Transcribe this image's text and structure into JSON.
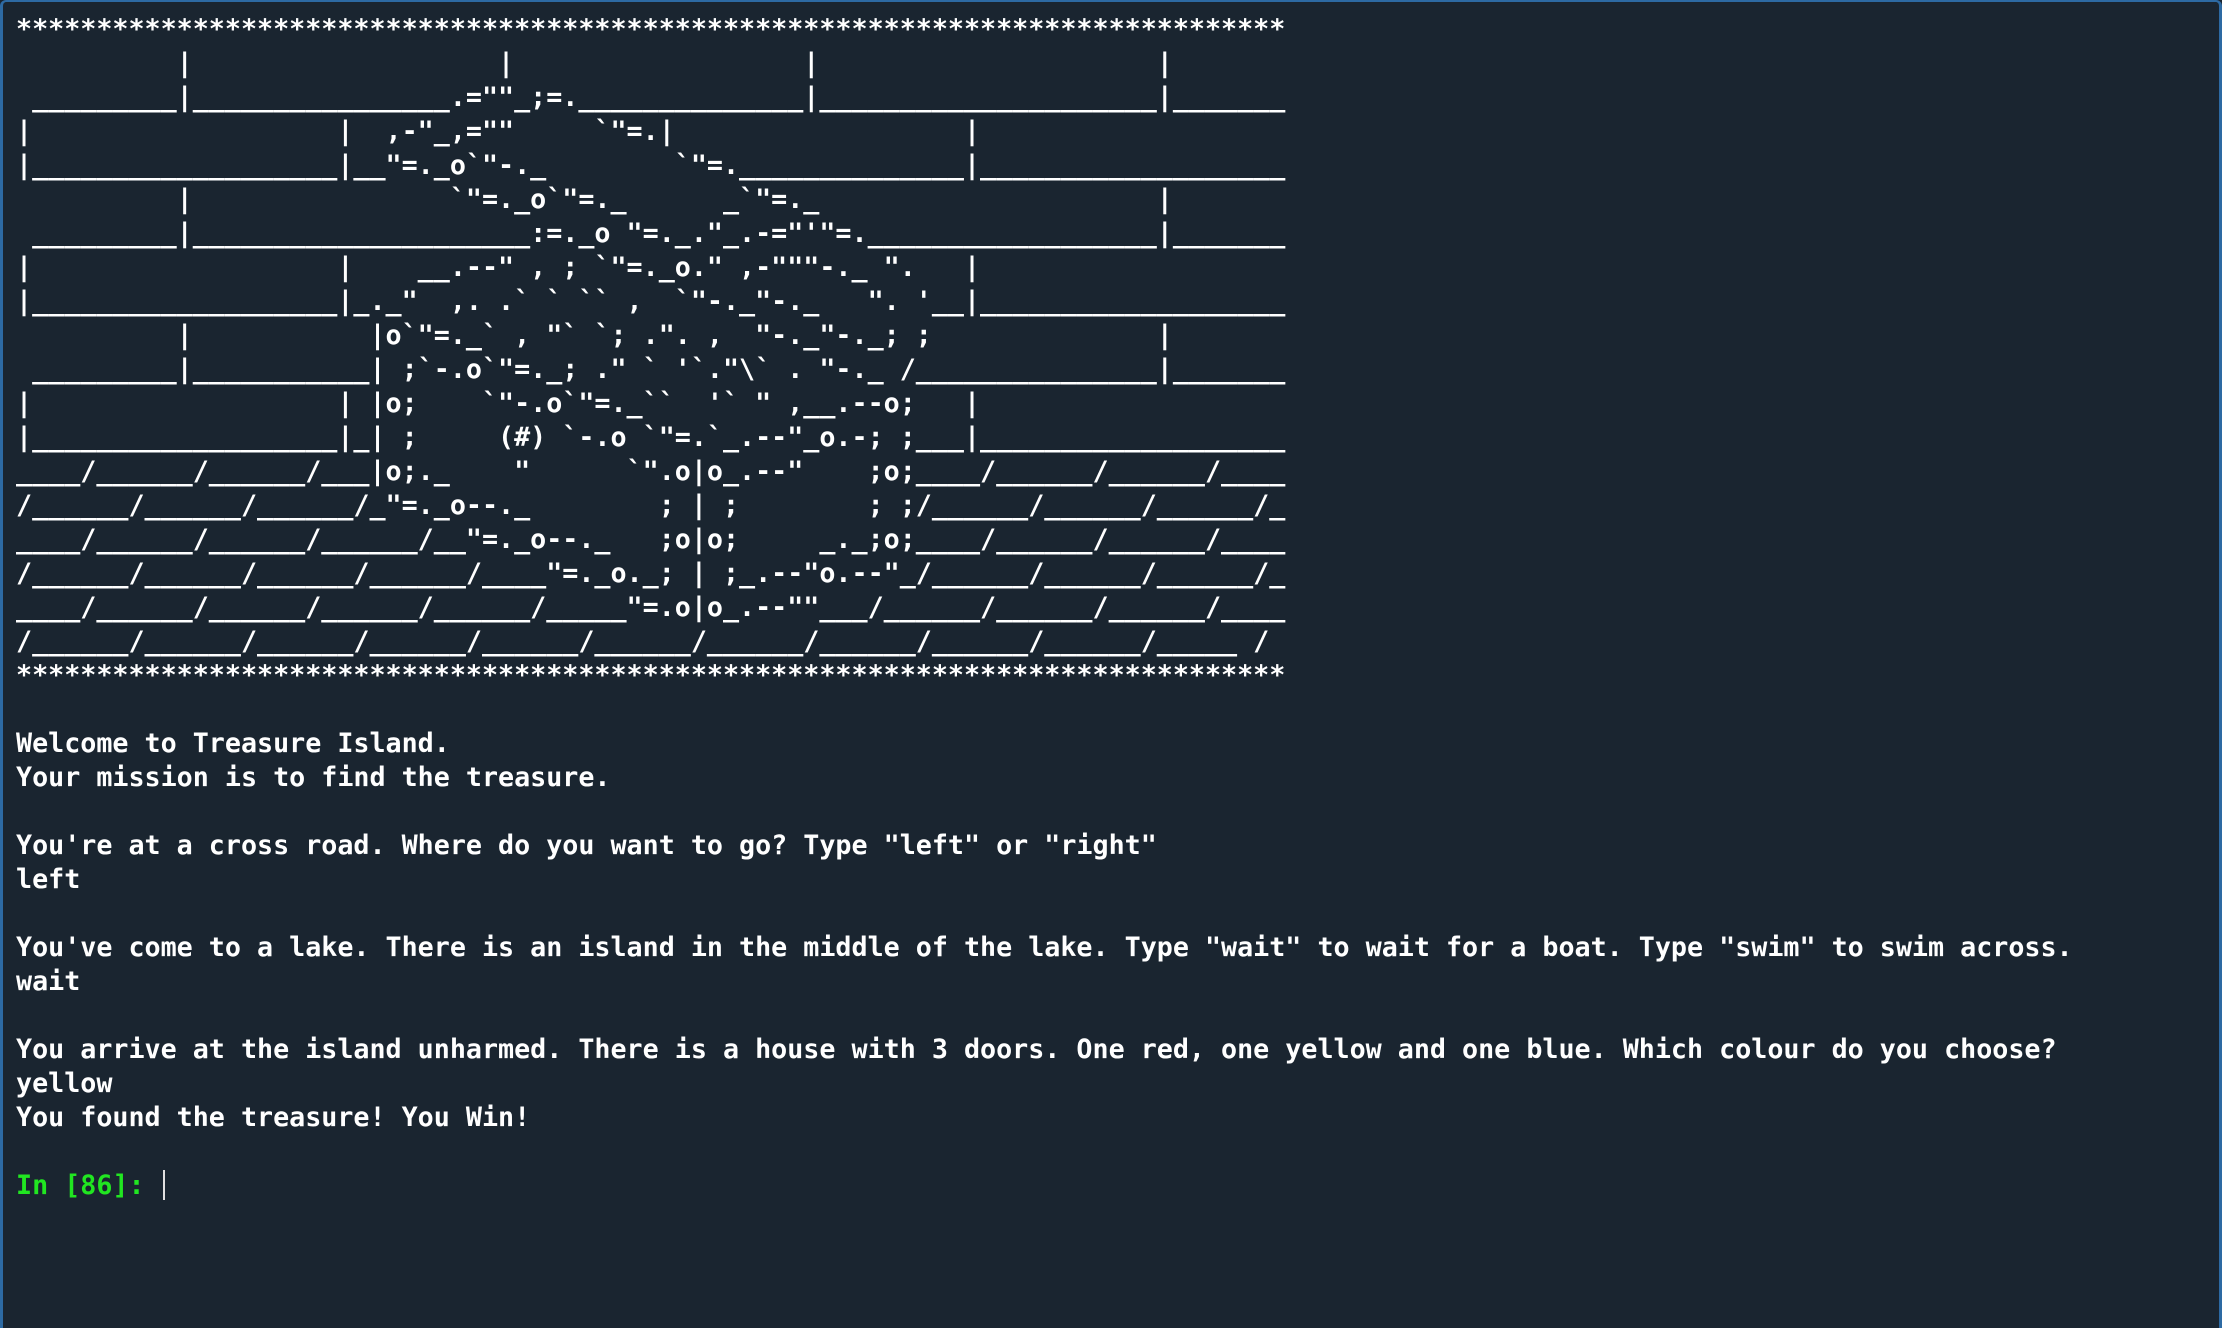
{
  "banner": {
    "art": "*******************************************************************************\n          |                   |                  |                     |\n _________|________________.=\"\"_;=.______________|_____________________|_______\n|                   |  ,-\"_,=\"\"     `\"=.|                  |\n|___________________|__\"=._o`\"-._        `\"=.______________|___________________\n          |                `\"=._o`\"=._      _`\"=._                     |\n _________|_____________________:=._o \"=._.\"_.-=\"'\"=.__________________|_______\n|                   |    __.--\" , ; `\"=._o.\" ,-\"\"\"-._ \".   |\n|___________________|_._\"  ,. .` ` `` ,  `\"-._\"-._   \". '__|___________________\n          |           |o`\"=._` , \"` `; .\". ,  \"-._\"-._; ;              |\n _________|___________| ;`-.o`\"=._; .\" ` '`.\"\\` . \"-._ /_______________|_______\n|                   | |o;    `\"-.o`\"=._``  '` \" ,__.--o;   |\n|___________________|_| ;     (#) `-.o `\"=.`_.--\"_o.-; ;___|___________________\n____/______/______/___|o;._    \"      `\".o|o_.--\"    ;o;____/______/______/____\n/______/______/______/_\"=._o--._        ; | ;        ; ;/______/______/______/_\n____/______/______/______/__\"=._o--._   ;o|o;     _._;o;____/______/______/____\n/______/______/______/______/____\"=._o._; | ;_.--\"o.--\"_/______/______/______/_\n____/______/______/______/______/_____\"=.o|o_.--\"\"___/______/______/______/____\n/______/______/______/______/______/______/______/______/______/______/_____ /\n*******************************************************************************"
  },
  "output": {
    "welcome": "Welcome to Treasure Island.",
    "mission": "Your mission is to find the treasure.",
    "question1": "You're at a cross road. Where do you want to go? Type \"left\" or \"right\"",
    "answer1": "left",
    "question2": "You've come to a lake. There is an island in the middle of the lake. Type \"wait\" to wait for a boat. Type \"swim\" to swim across.",
    "answer2": "wait",
    "question3": "You arrive at the island unharmed. There is a house with 3 doors. One red, one yellow and one blue. Which colour do you choose?",
    "answer3": "yellow",
    "result": "You found the treasure! You Win!"
  },
  "prompt": {
    "label": "In [",
    "number": "86",
    "suffix": "]: "
  },
  "colors": {
    "background": "#1a2530",
    "text": "#ffffff",
    "prompt": "#21e621",
    "border": "#2d6aa3"
  }
}
